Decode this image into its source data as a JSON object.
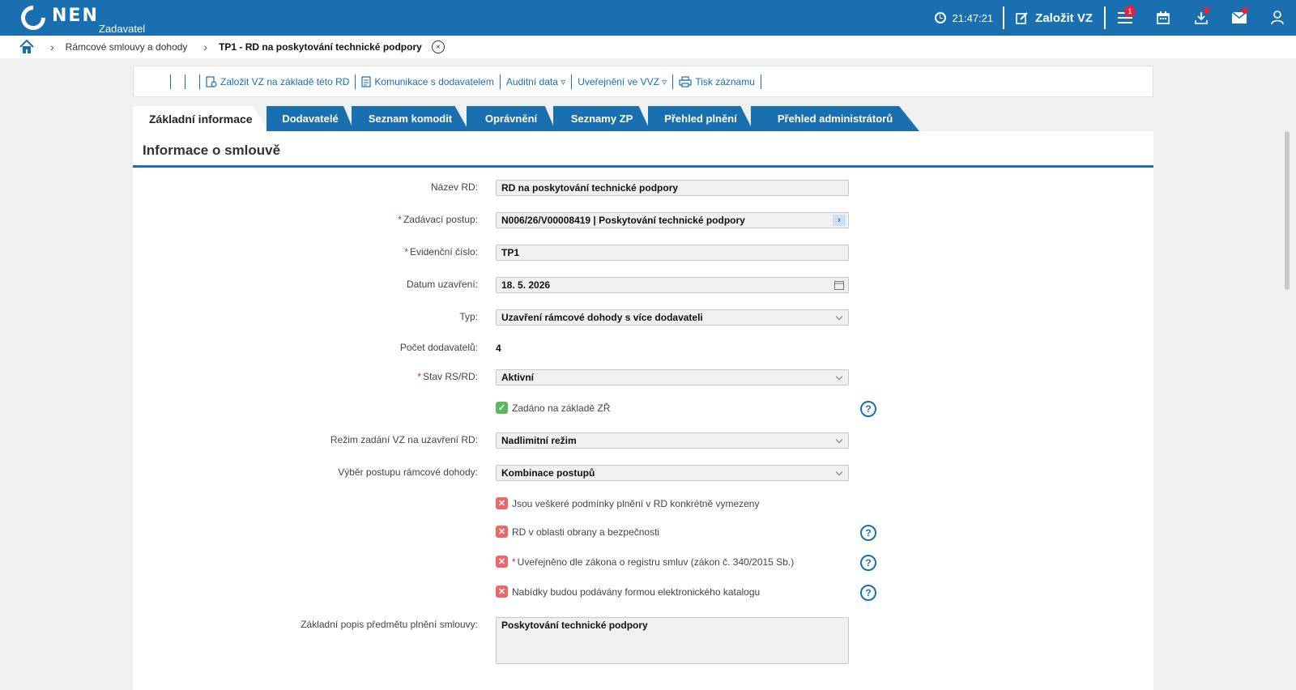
{
  "header": {
    "logo_text": "NEN",
    "logo_sub": "Zadavatel",
    "time": "21:47:21",
    "create_label": "Založit VZ",
    "notification_count": "1",
    "brand_color": "#1a6fb0"
  },
  "breadcrumb": {
    "link": "Rámcové smlouvy a dohody",
    "current": "TP1 - RD na poskytování technické podpory",
    "close": "×"
  },
  "toolbar": {
    "create_vz": "Založit VZ na základě této RD",
    "communicate": "Komunikace s dodavatelem",
    "audit": "Auditní data ▿",
    "publish": "Uveřejnění ve VVZ ▿",
    "print": "Tisk záznamu"
  },
  "tabs": [
    "Základní informace",
    "Dodavatelé",
    "Seznam komodit",
    "Oprávnění",
    "Seznamy ZP",
    "Přehled plnění",
    "Přehled administrátorů"
  ],
  "section": {
    "title": "Informace o smlouvě"
  },
  "form": {
    "nazev_label": "Název RD:",
    "nazev_value": "RD na poskytování technické podpory",
    "postup_label": "Zadávací postup:",
    "postup_value": "N006/26/V00008419 | Poskytování technické podpory",
    "evid_label": "Evidenční číslo:",
    "evid_value": "TP1",
    "datum_label": "Datum uzavření:",
    "datum_value": "18. 5. 2026",
    "typ_label": "Typ:",
    "typ_value": "Uzavření rámcové dohody s více dodavateli",
    "pocet_label": "Počet dodavatelů:",
    "pocet_value": "4",
    "stav_label": "Stav RS/RD:",
    "stav_value": "Aktivní",
    "zr_label": "Zadáno na základě ZŘ",
    "rezim_label": "Režim zadání VZ na uzavření RD:",
    "rezim_value": "Nadlimitní režim",
    "vyber_label": "Výběr postupu rámcové dohody:",
    "vyber_value": "Kombinace postupů",
    "chk1": "Jsou veškeré podmínky plnění v RD konkrétně vymezeny",
    "chk2": "RD v oblasti obrany a bezpečnosti",
    "chk3": "Uveřejněno dle zákona o registru smluv (zákon č. 340/2015 Sb.)",
    "chk4": "Nabídky budou podávány formou elektronického katalogu",
    "popis_label": "Základní popis předmětu plnění smlouvy:",
    "popis_value": "Poskytování technické podpory",
    "required_mark": "*",
    "help": "?"
  }
}
